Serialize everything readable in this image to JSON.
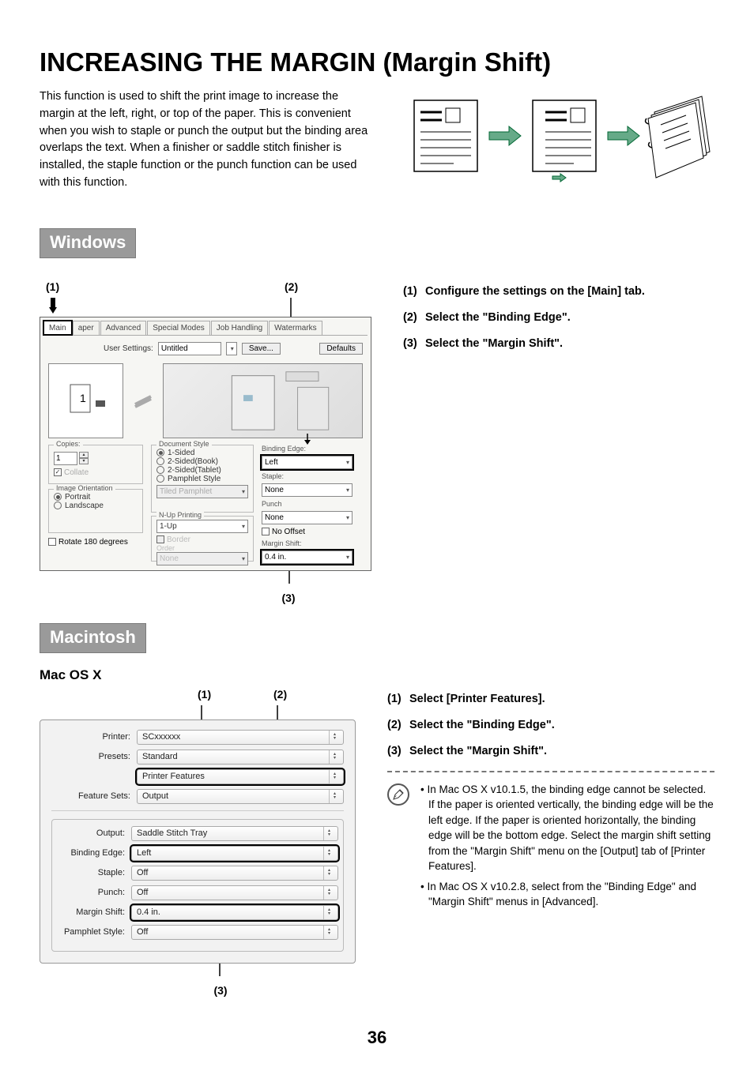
{
  "title": "INCREASING THE MARGIN (Margin Shift)",
  "intro": "This function is used to shift the print image to increase the margin at the left, right, or top of the paper. This is convenient when you wish to staple or punch the output but the binding area overlaps the text. When a finisher or saddle stitch finisher is installed, the staple function or the punch function can be used with this function.",
  "windows": {
    "heading": "Windows"
  },
  "mac": {
    "heading": "Macintosh",
    "sub": "Mac OS X"
  },
  "callouts": {
    "one": "(1)",
    "two": "(2)",
    "three": "(3)"
  },
  "winDialog": {
    "tabs": {
      "main": "Main",
      "paper": "aper",
      "advanced": "Advanced",
      "special": "Special Modes",
      "job": "Job Handling",
      "water": "Watermarks"
    },
    "userSettingsLabel": "User Settings:",
    "userSettingsValue": "Untitled",
    "save": "Save...",
    "defaults": "Defaults",
    "copiesLabel": "Copies:",
    "copiesValue": "1",
    "copiesNum": "1",
    "collate": "Collate",
    "imageOrientation": "Image Orientation",
    "portrait": "Portrait",
    "landscape": "Landscape",
    "rotate": "Rotate 180 degrees",
    "docStyle": "Document Style",
    "oneSided": "1-Sided",
    "twoSidedBook": "2-Sided(Book)",
    "twoSidedTablet": "2-Sided(Tablet)",
    "pamphlet": "Pamphlet Style",
    "tiled": "Tiled Pamphlet",
    "nup": "N-Up Printing",
    "nupValue": "1-Up",
    "border": "Border",
    "order": "Order",
    "none": "None",
    "bindingEdge": "Binding Edge:",
    "bindingEdgeValue": "Left",
    "stapleLabel": "Staple:",
    "stapleValue": "None",
    "punch": "Punch",
    "punchValue": "None",
    "noOffset": "No Offset",
    "marginShift": "Margin Shift:",
    "marginShiftValue": "0.4 in."
  },
  "winSteps": {
    "s1": "Configure the settings on the [Main] tab.",
    "s2": "Select the \"Binding Edge\".",
    "s3": "Select the \"Margin Shift\"."
  },
  "macDialog": {
    "printerLabel": "Printer:",
    "printerValue": "SCxxxxxx",
    "presetsLabel": "Presets:",
    "presetsValue": "Standard",
    "features": "Printer Features",
    "featureSetsLabel": "Feature Sets:",
    "featureSetsValue": "Output",
    "outputLabel": "Output:",
    "outputValue": "Saddle Stitch Tray",
    "bindingLabel": "Binding Edge:",
    "bindingValue": "Left",
    "stapleLabel": "Staple:",
    "stapleValue": "Off",
    "punchLabel": "Punch:",
    "punchValue": "Off",
    "marginLabel": "Margin Shift:",
    "marginValue": "0.4 in.",
    "pamphletLabel": "Pamphlet Style:",
    "pamphletValue": "Off"
  },
  "macSteps": {
    "s1": "Select [Printer Features].",
    "s2": "Select the \"Binding Edge\".",
    "s3": "Select the \"Margin Shift\"."
  },
  "notes": {
    "n1": "• In Mac OS X v10.1.5, the binding edge cannot be selected. If the paper is oriented vertically, the binding edge will be the left edge. If the paper is oriented horizontally, the binding edge will be the bottom edge. Select the margin shift setting from the \"Margin Shift\" menu on the [Output] tab of [Printer Features].",
    "n2": "• In Mac OS X v10.2.8, select from the \"Binding Edge\" and \"Margin Shift\" menus in [Advanced]."
  },
  "pageNumber": "36"
}
